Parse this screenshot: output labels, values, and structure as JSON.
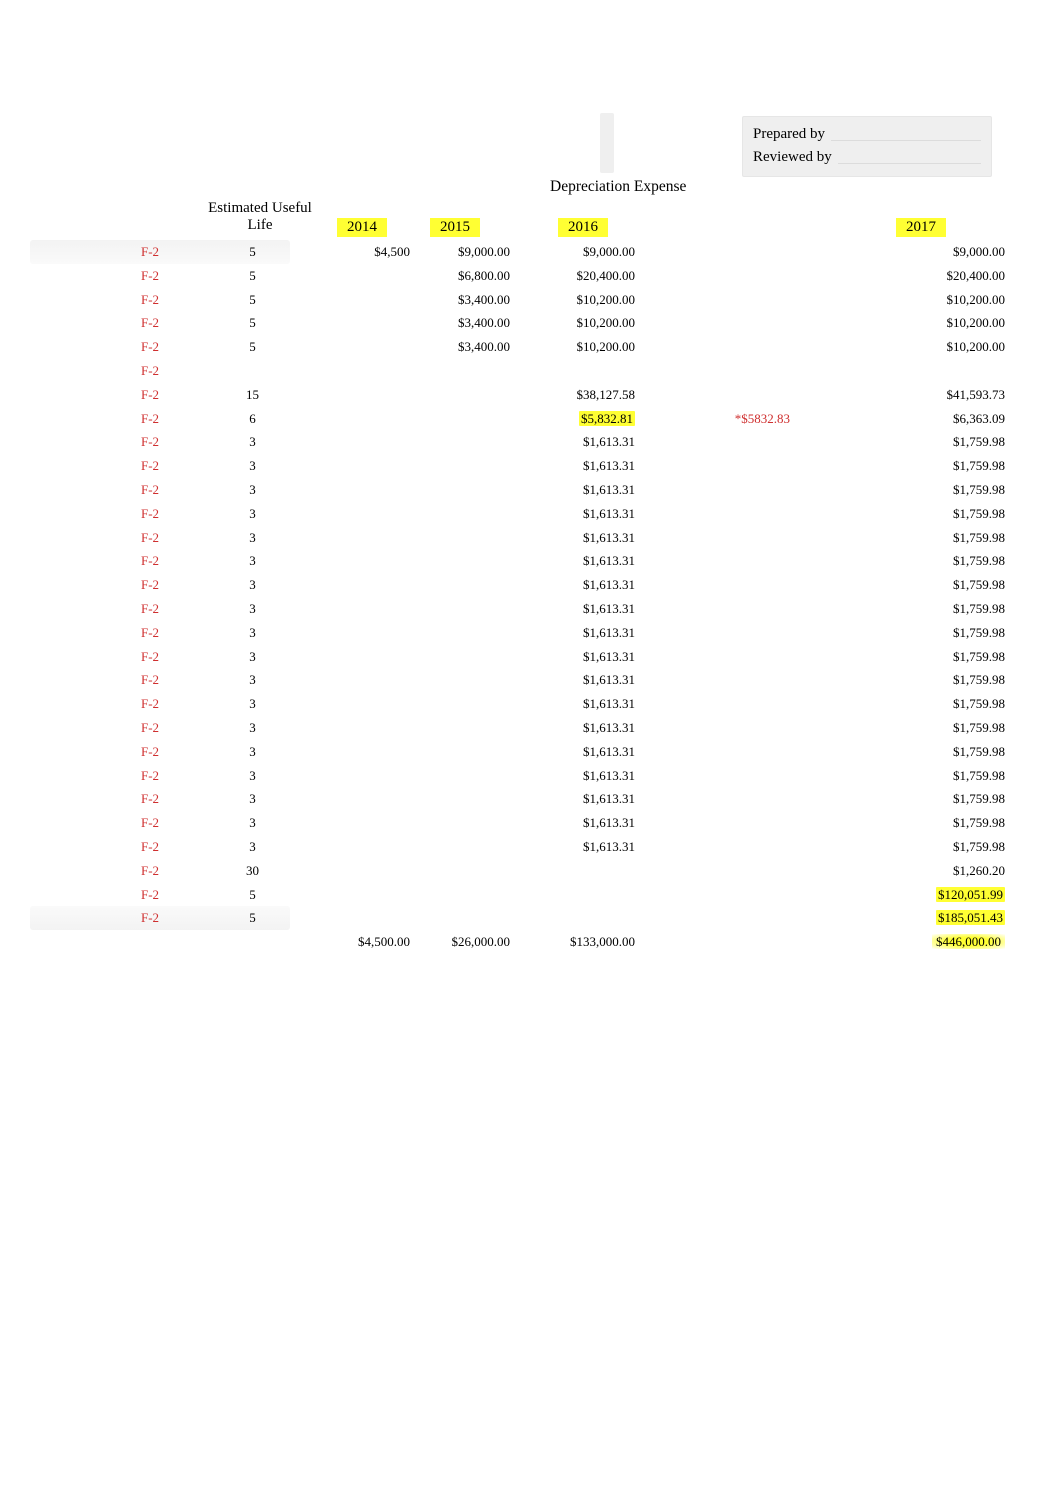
{
  "header": {
    "prepared_by_label": "Prepared by",
    "reviewed_by_label": "Reviewed by"
  },
  "section_title": "Depreciation Expense",
  "column_headers": {
    "useful_life": "Estimated Useful Life",
    "y2014": "2014",
    "y2015": "2015",
    "y2016": "2016",
    "y2017": "2017"
  },
  "rows": [
    {
      "tag": "F-2",
      "life": "5",
      "c2014": "$4,500",
      "c2015": "$9,000.00",
      "c2016": "$9,000.00",
      "c2017": "$9,000.00",
      "shade": "top"
    },
    {
      "tag": "F-2",
      "life": "5",
      "c2015": "$6,800.00",
      "c2016": "$20,400.00",
      "c2017": "$20,400.00"
    },
    {
      "tag": "F-2",
      "life": "5",
      "c2015": "$3,400.00",
      "c2016": "$10,200.00",
      "c2017": "$10,200.00"
    },
    {
      "tag": "F-2",
      "life": "5",
      "c2015": "$3,400.00",
      "c2016": "$10,200.00",
      "c2017": "$10,200.00"
    },
    {
      "tag": "F-2",
      "life": "5",
      "c2015": "$3,400.00",
      "c2016": "$10,200.00",
      "c2017": "$10,200.00"
    },
    {
      "tag": "F-2"
    },
    {
      "tag": "F-2",
      "life": "15",
      "c2016": "$38,127.58",
      "c2017": "$41,593.73"
    },
    {
      "tag": "F-2",
      "life": "6",
      "c2016": "$5,832.81",
      "c2016_hl": true,
      "cnote": "*$5832.83",
      "c2017": "$6,363.09"
    },
    {
      "tag": "F-2",
      "life": "3",
      "c2016": "$1,613.31",
      "c2017": "$1,759.98"
    },
    {
      "tag": "F-2",
      "life": "3",
      "c2016": "$1,613.31",
      "c2017": "$1,759.98"
    },
    {
      "tag": "F-2",
      "life": "3",
      "c2016": "$1,613.31",
      "c2017": "$1,759.98"
    },
    {
      "tag": "F-2",
      "life": "3",
      "c2016": "$1,613.31",
      "c2017": "$1,759.98"
    },
    {
      "tag": "F-2",
      "life": "3",
      "c2016": "$1,613.31",
      "c2017": "$1,759.98"
    },
    {
      "tag": "F-2",
      "life": "3",
      "c2016": "$1,613.31",
      "c2017": "$1,759.98"
    },
    {
      "tag": "F-2",
      "life": "3",
      "c2016": "$1,613.31",
      "c2017": "$1,759.98"
    },
    {
      "tag": "F-2",
      "life": "3",
      "c2016": "$1,613.31",
      "c2017": "$1,759.98"
    },
    {
      "tag": "F-2",
      "life": "3",
      "c2016": "$1,613.31",
      "c2017": "$1,759.98"
    },
    {
      "tag": "F-2",
      "life": "3",
      "c2016": "$1,613.31",
      "c2017": "$1,759.98"
    },
    {
      "tag": "F-2",
      "life": "3",
      "c2016": "$1,613.31",
      "c2017": "$1,759.98"
    },
    {
      "tag": "F-2",
      "life": "3",
      "c2016": "$1,613.31",
      "c2017": "$1,759.98"
    },
    {
      "tag": "F-2",
      "life": "3",
      "c2016": "$1,613.31",
      "c2017": "$1,759.98"
    },
    {
      "tag": "F-2",
      "life": "3",
      "c2016": "$1,613.31",
      "c2017": "$1,759.98"
    },
    {
      "tag": "F-2",
      "life": "3",
      "c2016": "$1,613.31",
      "c2017": "$1,759.98"
    },
    {
      "tag": "F-2",
      "life": "3",
      "c2016": "$1,613.31",
      "c2017": "$1,759.98"
    },
    {
      "tag": "F-2",
      "life": "3",
      "c2016": "$1,613.31",
      "c2017": "$1,759.98"
    },
    {
      "tag": "F-2",
      "life": "3",
      "c2016": "$1,613.31",
      "c2017": "$1,759.98"
    },
    {
      "tag": "F-2",
      "life": "30",
      "c2017": "$1,260.20"
    },
    {
      "tag": "F-2",
      "life": "5",
      "c2017": "$120,051.99",
      "c2017_hl": true
    },
    {
      "tag": "F-2",
      "life": "5",
      "c2017": "$185,051.43",
      "c2017_hl": true,
      "shade": "bottom"
    }
  ],
  "totals": {
    "c2014": "$4,500.00",
    "c2015": "$26,000.00",
    "c2016": "$133,000.00",
    "c2017": "$446,000.00",
    "c2017_hl": true
  }
}
